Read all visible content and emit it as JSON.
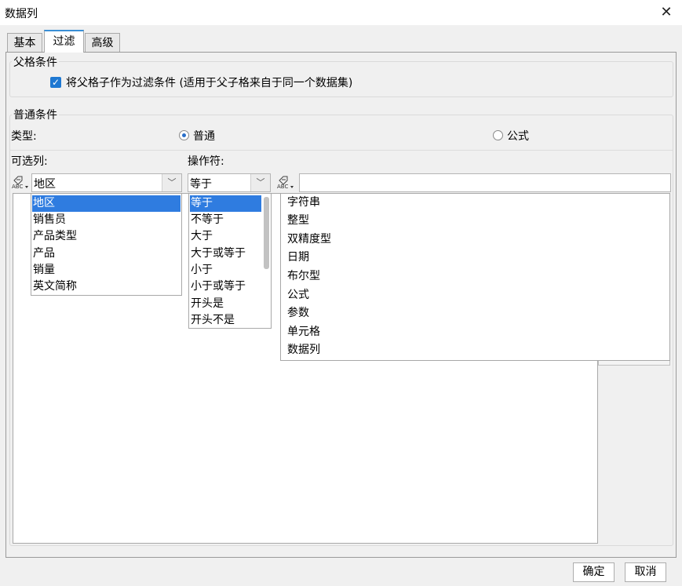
{
  "window": {
    "title": "数据列"
  },
  "tabs": [
    {
      "label": "基本"
    },
    {
      "label": "过滤"
    },
    {
      "label": "高级"
    }
  ],
  "parent_condition": {
    "title": "父格条件",
    "checkbox_label": "将父格子作为过滤条件 (适用于父子格来自于同一个数据集)",
    "checked": true
  },
  "normal_condition": {
    "title": "普通条件",
    "type_label": "类型:",
    "type_options": [
      {
        "label": "普通",
        "selected": true
      },
      {
        "label": "公式",
        "selected": false
      }
    ],
    "column_label": "可选列:",
    "operator_label": "操作符:"
  },
  "column_combo": {
    "value": "地区",
    "icon": "abc-column-icon"
  },
  "operator_combo": {
    "value": "等于"
  },
  "value_type_icon": "abc-type-icon",
  "value_input": {
    "value": ""
  },
  "column_list": {
    "items": [
      "地区",
      "销售员",
      "产品类型",
      "产品",
      "销量",
      "英文简称"
    ],
    "selected": "地区"
  },
  "operator_list": {
    "items": [
      "等于",
      "不等于",
      "大于",
      "大于或等于",
      "小于",
      "小于或等于",
      "开头是",
      "开头不是"
    ],
    "selected": "等于"
  },
  "type_list": {
    "items": [
      "字符串",
      "整型",
      "双精度型",
      "日期",
      "布尔型",
      "公式",
      "参数",
      "单元格",
      "数据列"
    ]
  },
  "buttons": {
    "ok": "确定",
    "cancel": "取消"
  },
  "colors": {
    "accent": "#2f7ce0",
    "checkbox": "#1e78d2"
  }
}
